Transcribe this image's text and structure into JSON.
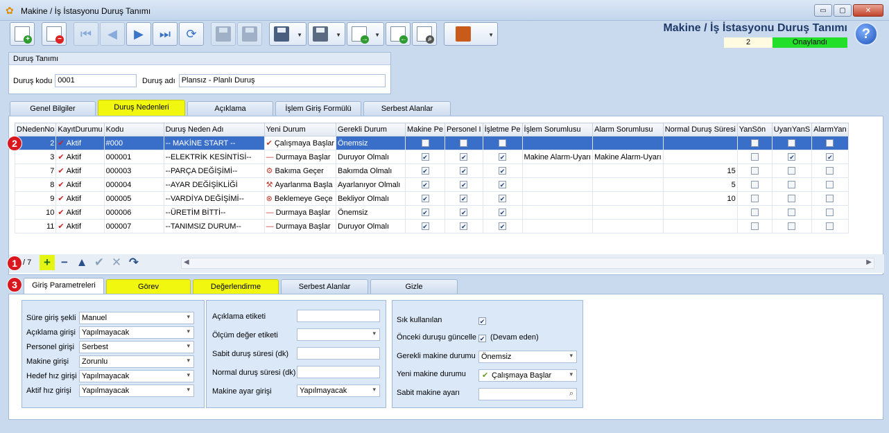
{
  "window": {
    "title": "Makine / İş İstasyonu Duruş Tanımı",
    "controls": [
      "▭",
      "▢",
      "✕"
    ]
  },
  "header": {
    "title": "Makine / İş İstasyonu Duruş Tanımı",
    "record_no": "2",
    "status": "Onaylandı",
    "help": "?"
  },
  "record": {
    "legend": "Duruş Tanımı",
    "code_label": "Duruş kodu",
    "code_value": "0001",
    "name_label": "Duruş adı",
    "name_value": "Plansız - Planlı Duruş"
  },
  "main_tabs": [
    "Genel Bilgiler",
    "Duruş Nedenleri",
    "Açıklama",
    "İşlem Giriş Formülü",
    "Serbest Alanlar"
  ],
  "grid": {
    "columns": [
      "DNedenNo",
      "KayıtDurumu",
      "Kodu",
      "Duruş Neden Adı",
      "Yeni Durum",
      "Gerekli Durum",
      "Makine Pe",
      "Personel I",
      "İşletme Pe",
      "İşlem Sorumlusu",
      "Alarm Sorumlusu",
      "Normal Duruş Süresi",
      "YanSön",
      "UyarıYanS",
      "AlarmYan"
    ],
    "rows": [
      {
        "no": "2",
        "status": "Aktif",
        "code": "#000",
        "name": "-- MAKİNE START --",
        "yd_icon": "✔",
        "yd": "Çalışmaya Başlar",
        "gd": "Önemsiz",
        "m": false,
        "p": false,
        "i": false,
        "islem": "",
        "alarm": "",
        "sure": "",
        "ys": false,
        "uy": false,
        "al": false
      },
      {
        "no": "3",
        "status": "Aktif",
        "code": "000001",
        "name": "--ELEKTRİK KESİNTİSİ--",
        "yd_icon": "—",
        "yd": "Durmaya Başlar",
        "gd": "Duruyor Olmalı",
        "m": true,
        "p": true,
        "i": true,
        "islem": "Makine Alarm-Uyarı",
        "alarm": "Makine Alarm-Uyarı",
        "sure": "",
        "ys": false,
        "uy": true,
        "al": true
      },
      {
        "no": "7",
        "status": "Aktif",
        "code": "000003",
        "name": "--PARÇA DEĞİŞİMİ--",
        "yd_icon": "⚙",
        "yd": "Bakıma Geçer",
        "gd": "Bakımda Olmalı",
        "m": true,
        "p": true,
        "i": true,
        "islem": "",
        "alarm": "",
        "sure": "15",
        "ys": false,
        "uy": false,
        "al": false
      },
      {
        "no": "8",
        "status": "Aktif",
        "code": "000004",
        "name": "--AYAR DEĞİŞİKLİĞİ",
        "yd_icon": "⚒",
        "yd": "Ayarlanma Başla",
        "gd": "Ayarlanıyor Olmalı",
        "m": true,
        "p": true,
        "i": true,
        "islem": "",
        "alarm": "",
        "sure": "5",
        "ys": false,
        "uy": false,
        "al": false
      },
      {
        "no": "9",
        "status": "Aktif",
        "code": "000005",
        "name": "--VARDİYA DEĞİŞİMİ--",
        "yd_icon": "⊗",
        "yd": "Beklemeye Geçe",
        "gd": "Bekliyor Olmalı",
        "m": true,
        "p": true,
        "i": true,
        "islem": "",
        "alarm": "",
        "sure": "10",
        "ys": false,
        "uy": false,
        "al": false
      },
      {
        "no": "10",
        "status": "Aktif",
        "code": "000006",
        "name": "--ÜRETİM BİTTİ--",
        "yd_icon": "—",
        "yd": "Durmaya Başlar",
        "gd": "Önemsiz",
        "m": true,
        "p": true,
        "i": true,
        "islem": "",
        "alarm": "",
        "sure": "",
        "ys": false,
        "uy": false,
        "al": false
      },
      {
        "no": "11",
        "status": "Aktif",
        "code": "000007",
        "name": "--TANIMSIZ DURUM--",
        "yd_icon": "—",
        "yd": "Durmaya Başlar",
        "gd": "Duruyor Olmalı",
        "m": true,
        "p": true,
        "i": true,
        "islem": "",
        "alarm": "",
        "sure": "",
        "ys": false,
        "uy": false,
        "al": false
      }
    ],
    "pager": "/ 7",
    "nav": [
      "+",
      "−",
      "▲",
      "✔",
      "✕",
      "↷"
    ]
  },
  "markers": [
    "1",
    "2",
    "3"
  ],
  "sub_tabs": [
    "Giriş Parametreleri",
    "Görev",
    "Değerlendirme",
    "Serbest Alanlar",
    "Gizle"
  ],
  "params": {
    "left": [
      {
        "label": "Süre giriş şekli",
        "value": "Manuel"
      },
      {
        "label": "Açıklama girişi",
        "value": "Yapılmayacak"
      },
      {
        "label": "Personel girişi",
        "value": "Serbest"
      },
      {
        "label": "Makine girişi",
        "value": "Zorunlu"
      },
      {
        "label": "Hedef hız girişi",
        "value": "Yapılmayacak"
      },
      {
        "label": "Aktif hız girişi",
        "value": "Yapılmayacak"
      }
    ],
    "middle": [
      {
        "label": "Açıklama etiketi",
        "value": ""
      },
      {
        "label": "Ölçüm değer etiketi",
        "value": ""
      },
      {
        "label": "Sabit duruş süresi (dk)",
        "value": ""
      },
      {
        "label": "Normal duruş süresi (dk)",
        "value": ""
      },
      {
        "label": "Makine ayar girişi",
        "value": "Yapılmayacak"
      }
    ],
    "right": {
      "sik_label": "Sık kullanılan",
      "onceki_label": "Önceki duruşu güncelle",
      "onceki_note": "(Devam eden)",
      "gerekli_label": "Gerekli makine durumu",
      "gerekli_value": "Önemsiz",
      "yeni_label": "Yeni makine durumu",
      "yeni_value": "Çalışmaya Başlar",
      "sabit_label": "Sabit makine ayarı"
    }
  }
}
